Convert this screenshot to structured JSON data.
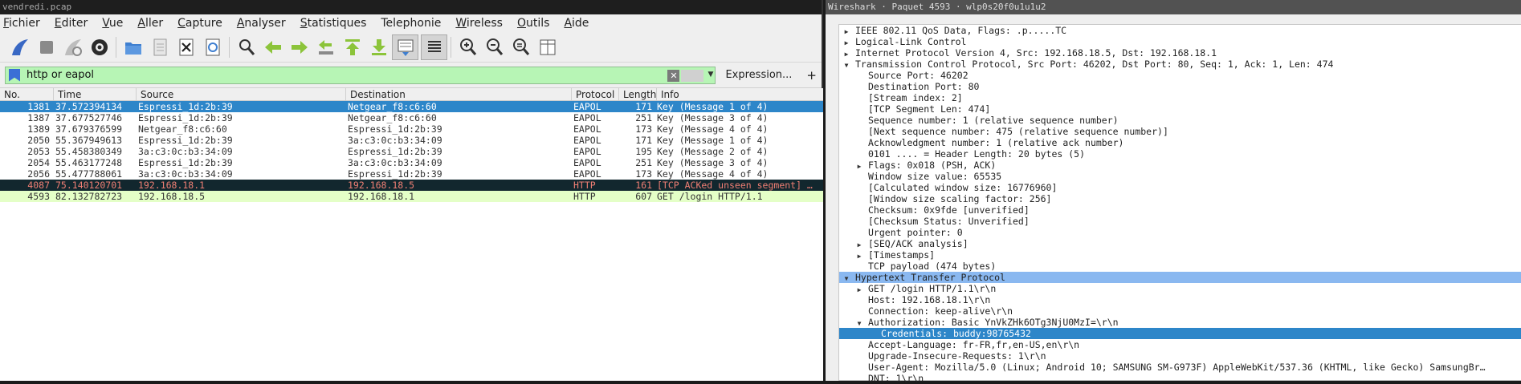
{
  "left_window": {
    "title": "vendredi.pcap",
    "menu": [
      {
        "label": "Fichier",
        "ul": "F"
      },
      {
        "label": "Editer",
        "ul": "E"
      },
      {
        "label": "Vue",
        "ul": "V"
      },
      {
        "label": "Aller",
        "ul": "A"
      },
      {
        "label": "Capture",
        "ul": "C"
      },
      {
        "label": "Analyser",
        "ul": "A"
      },
      {
        "label": "Statistiques",
        "ul": "S"
      },
      {
        "label": "Telephonie",
        "ul": "y"
      },
      {
        "label": "Wireless",
        "ul": "W"
      },
      {
        "label": "Outils",
        "ul": "O"
      },
      {
        "label": "Aide",
        "ul": "A"
      }
    ],
    "filter": {
      "text": "http or eapol",
      "expression_label": "Expression...",
      "plus": "+",
      "clear": "✕"
    },
    "columns": [
      "No.",
      "Time",
      "Source",
      "Destination",
      "Protocol",
      "Length",
      "Info"
    ],
    "packets": [
      {
        "no": "1381",
        "time": "37.572394134",
        "src": "Espressi_1d:2b:39",
        "dst": "Netgear_f8:c6:60",
        "proto": "EAPOL",
        "len": "171",
        "info": "Key (Message 1 of 4)",
        "style": "sel"
      },
      {
        "no": "1387",
        "time": "37.677527746",
        "src": "Espressi_1d:2b:39",
        "dst": "Netgear_f8:c6:60",
        "proto": "EAPOL",
        "len": "251",
        "info": "Key (Message 3 of 4)",
        "style": "eapol"
      },
      {
        "no": "1389",
        "time": "37.679376599",
        "src": "Netgear_f8:c6:60",
        "dst": "Espressi_1d:2b:39",
        "proto": "EAPOL",
        "len": "173",
        "info": "Key (Message 4 of 4)",
        "style": "eapol"
      },
      {
        "no": "2050",
        "time": "55.367949613",
        "src": "Espressi_1d:2b:39",
        "dst": "3a:c3:0c:b3:34:09",
        "proto": "EAPOL",
        "len": "171",
        "info": "Key (Message 1 of 4)",
        "style": "eapol"
      },
      {
        "no": "2053",
        "time": "55.458380349",
        "src": "3a:c3:0c:b3:34:09",
        "dst": "Espressi_1d:2b:39",
        "proto": "EAPOL",
        "len": "195",
        "info": "Key (Message 2 of 4)",
        "style": "eapol"
      },
      {
        "no": "2054",
        "time": "55.463177248",
        "src": "Espressi_1d:2b:39",
        "dst": "3a:c3:0c:b3:34:09",
        "proto": "EAPOL",
        "len": "251",
        "info": "Key (Message 3 of 4)",
        "style": "eapol"
      },
      {
        "no": "2056",
        "time": "55.477788061",
        "src": "3a:c3:0c:b3:34:09",
        "dst": "Espressi_1d:2b:39",
        "proto": "EAPOL",
        "len": "173",
        "info": "Key (Message 4 of 4)",
        "style": "eapol"
      },
      {
        "no": "4087",
        "time": "75.140120701",
        "src": "192.168.18.1",
        "dst": "192.168.18.5",
        "proto": "HTTP",
        "len": "161",
        "info": "[TCP ACKed unseen segment] …",
        "style": "dark"
      },
      {
        "no": "4593",
        "time": "82.132782723",
        "src": "192.168.18.5",
        "dst": "192.168.18.1",
        "proto": "HTTP",
        "len": "607",
        "info": "GET /login HTTP/1.1",
        "style": "http"
      }
    ]
  },
  "right_window": {
    "title": "Wireshark · Paquet 4593 · wlp0s20f0u1u1u2",
    "tree": [
      {
        "indent": 0,
        "arrow": "right",
        "text": "IEEE 802.11 QoS Data, Flags: .p.....TC"
      },
      {
        "indent": 0,
        "arrow": "right",
        "text": "Logical-Link Control"
      },
      {
        "indent": 0,
        "arrow": "right",
        "text": "Internet Protocol Version 4, Src: 192.168.18.5, Dst: 192.168.18.1"
      },
      {
        "indent": 0,
        "arrow": "down",
        "text": "Transmission Control Protocol, Src Port: 46202, Dst Port: 80, Seq: 1, Ack: 1, Len: 474"
      },
      {
        "indent": 1,
        "arrow": "",
        "text": "Source Port: 46202"
      },
      {
        "indent": 1,
        "arrow": "",
        "text": "Destination Port: 80"
      },
      {
        "indent": 1,
        "arrow": "",
        "text": "[Stream index: 2]"
      },
      {
        "indent": 1,
        "arrow": "",
        "text": "[TCP Segment Len: 474]"
      },
      {
        "indent": 1,
        "arrow": "",
        "text": "Sequence number: 1    (relative sequence number)"
      },
      {
        "indent": 1,
        "arrow": "",
        "text": "[Next sequence number: 475    (relative sequence number)]"
      },
      {
        "indent": 1,
        "arrow": "",
        "text": "Acknowledgment number: 1    (relative ack number)"
      },
      {
        "indent": 1,
        "arrow": "",
        "text": "0101 .... = Header Length: 20 bytes (5)"
      },
      {
        "indent": 1,
        "arrow": "right",
        "text": "Flags: 0x018 (PSH, ACK)"
      },
      {
        "indent": 1,
        "arrow": "",
        "text": "Window size value: 65535"
      },
      {
        "indent": 1,
        "arrow": "",
        "text": "[Calculated window size: 16776960]"
      },
      {
        "indent": 1,
        "arrow": "",
        "text": "[Window size scaling factor: 256]"
      },
      {
        "indent": 1,
        "arrow": "",
        "text": "Checksum: 0x9fde [unverified]"
      },
      {
        "indent": 1,
        "arrow": "",
        "text": "[Checksum Status: Unverified]"
      },
      {
        "indent": 1,
        "arrow": "",
        "text": "Urgent pointer: 0"
      },
      {
        "indent": 1,
        "arrow": "right",
        "text": "[SEQ/ACK analysis]"
      },
      {
        "indent": 1,
        "arrow": "right",
        "text": "[Timestamps]"
      },
      {
        "indent": 1,
        "arrow": "",
        "text": "TCP payload (474 bytes)"
      },
      {
        "indent": 0,
        "arrow": "down",
        "text": "Hypertext Transfer Protocol",
        "style": "sel"
      },
      {
        "indent": 1,
        "arrow": "right",
        "text": "GET /login HTTP/1.1\\r\\n"
      },
      {
        "indent": 1,
        "arrow": "",
        "text": "Host: 192.168.18.1\\r\\n"
      },
      {
        "indent": 1,
        "arrow": "",
        "text": "Connection: keep-alive\\r\\n"
      },
      {
        "indent": 1,
        "arrow": "down",
        "text": "Authorization: Basic YnVkZHk6OTg3NjU0MzI=\\r\\n"
      },
      {
        "indent": 2,
        "arrow": "",
        "text": "Credentials: buddy:98765432",
        "style": "sel2"
      },
      {
        "indent": 1,
        "arrow": "",
        "text": "Accept-Language: fr-FR,fr,en-US,en\\r\\n"
      },
      {
        "indent": 1,
        "arrow": "",
        "text": "Upgrade-Insecure-Requests: 1\\r\\n"
      },
      {
        "indent": 1,
        "arrow": "",
        "text": "User-Agent: Mozilla/5.0 (Linux; Android 10; SAMSUNG SM-G973F) AppleWebKit/537.36 (KHTML, like Gecko) SamsungBr…"
      },
      {
        "indent": 1,
        "arrow": "",
        "text": "DNT: 1\\r\\n"
      }
    ]
  },
  "colors": {
    "accent": "#2d86c9",
    "filter_ok": "#b7f5b5",
    "http_row": "#e4ffc7",
    "dark_row": "#12272e",
    "dark_row_text": "#f07f74"
  }
}
